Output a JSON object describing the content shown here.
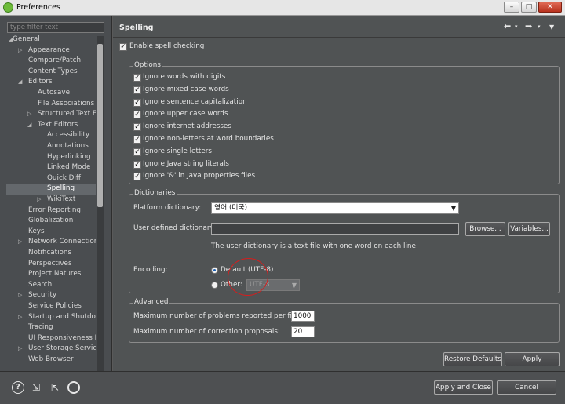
{
  "window": {
    "title": "Preferences",
    "minimize": "–",
    "maximize": "□",
    "close": "✕"
  },
  "filter": {
    "placeholder": "type filter text"
  },
  "tree": [
    {
      "label": "General",
      "indent": 0,
      "arrow": "◢"
    },
    {
      "label": "Appearance",
      "indent": 1,
      "arrow": "▷"
    },
    {
      "label": "Compare/Patch",
      "indent": 1,
      "arrow": ""
    },
    {
      "label": "Content Types",
      "indent": 1,
      "arrow": ""
    },
    {
      "label": "Editors",
      "indent": 1,
      "arrow": "◢"
    },
    {
      "label": "Autosave",
      "indent": 2,
      "arrow": ""
    },
    {
      "label": "File Associations",
      "indent": 2,
      "arrow": ""
    },
    {
      "label": "Structured Text Ec",
      "indent": 2,
      "arrow": "▷"
    },
    {
      "label": "Text Editors",
      "indent": 2,
      "arrow": "◢"
    },
    {
      "label": "Accessibility",
      "indent": 3,
      "arrow": ""
    },
    {
      "label": "Annotations",
      "indent": 3,
      "arrow": ""
    },
    {
      "label": "Hyperlinking",
      "indent": 3,
      "arrow": ""
    },
    {
      "label": "Linked Mode",
      "indent": 3,
      "arrow": ""
    },
    {
      "label": "Quick Diff",
      "indent": 3,
      "arrow": ""
    },
    {
      "label": "Spelling",
      "indent": 3,
      "arrow": "",
      "selected": true
    },
    {
      "label": "WikiText",
      "indent": 3,
      "arrow": "▷"
    },
    {
      "label": "Error Reporting",
      "indent": 1,
      "arrow": ""
    },
    {
      "label": "Globalization",
      "indent": 1,
      "arrow": ""
    },
    {
      "label": "Keys",
      "indent": 1,
      "arrow": ""
    },
    {
      "label": "Network Connection",
      "indent": 1,
      "arrow": "▷"
    },
    {
      "label": "Notifications",
      "indent": 1,
      "arrow": ""
    },
    {
      "label": "Perspectives",
      "indent": 1,
      "arrow": ""
    },
    {
      "label": "Project Natures",
      "indent": 1,
      "arrow": ""
    },
    {
      "label": "Search",
      "indent": 1,
      "arrow": ""
    },
    {
      "label": "Security",
      "indent": 1,
      "arrow": "▷"
    },
    {
      "label": "Service Policies",
      "indent": 1,
      "arrow": ""
    },
    {
      "label": "Startup and Shutdov",
      "indent": 1,
      "arrow": "▷"
    },
    {
      "label": "Tracing",
      "indent": 1,
      "arrow": ""
    },
    {
      "label": "UI Responsiveness M",
      "indent": 1,
      "arrow": ""
    },
    {
      "label": "User Storage Service",
      "indent": 1,
      "arrow": "▷"
    },
    {
      "label": "Web Browser",
      "indent": 1,
      "arrow": ""
    }
  ],
  "page": {
    "title": "Spelling",
    "back_icon": "back-arrow-icon",
    "forward_icon": "forward-arrow-icon",
    "enable": {
      "label": "Enable spell checking",
      "checked": true
    }
  },
  "options": {
    "title": "Options",
    "items": [
      "Ignore words with digits",
      "Ignore mixed case words",
      "Ignore sentence capitalization",
      "Ignore upper case words",
      "Ignore internet addresses",
      "Ignore non-letters at word boundaries",
      "Ignore single letters",
      "Ignore Java string literals",
      "Ignore '&' in Java properties files"
    ],
    "checked": true
  },
  "dictionaries": {
    "title": "Dictionaries",
    "platform_label": "Platform dictionary:",
    "platform_value": "영어 (미국)",
    "user_label": "User defined dictionary:",
    "user_value": "",
    "browse": "Browse...",
    "variables": "Variables...",
    "hint": "The user dictionary is a text file with one word on each line",
    "encoding_label": "Encoding:",
    "default_label": "Default (UTF-8)",
    "other_label": "Other:",
    "other_value": "UTF-8",
    "default_selected": true
  },
  "advanced": {
    "title": "Advanced",
    "max_problems_label": "Maximum number of problems reported per file:",
    "max_problems_value": "1000",
    "max_proposals_label": "Maximum number of correction proposals:",
    "max_proposals_value": "20"
  },
  "buttons": {
    "restore_defaults": "Restore Defaults",
    "apply": "Apply",
    "apply_close": "Apply and Close",
    "cancel": "Cancel"
  },
  "bottom_icons": [
    "help-icon",
    "import-icon",
    "export-icon",
    "settings-icon"
  ]
}
